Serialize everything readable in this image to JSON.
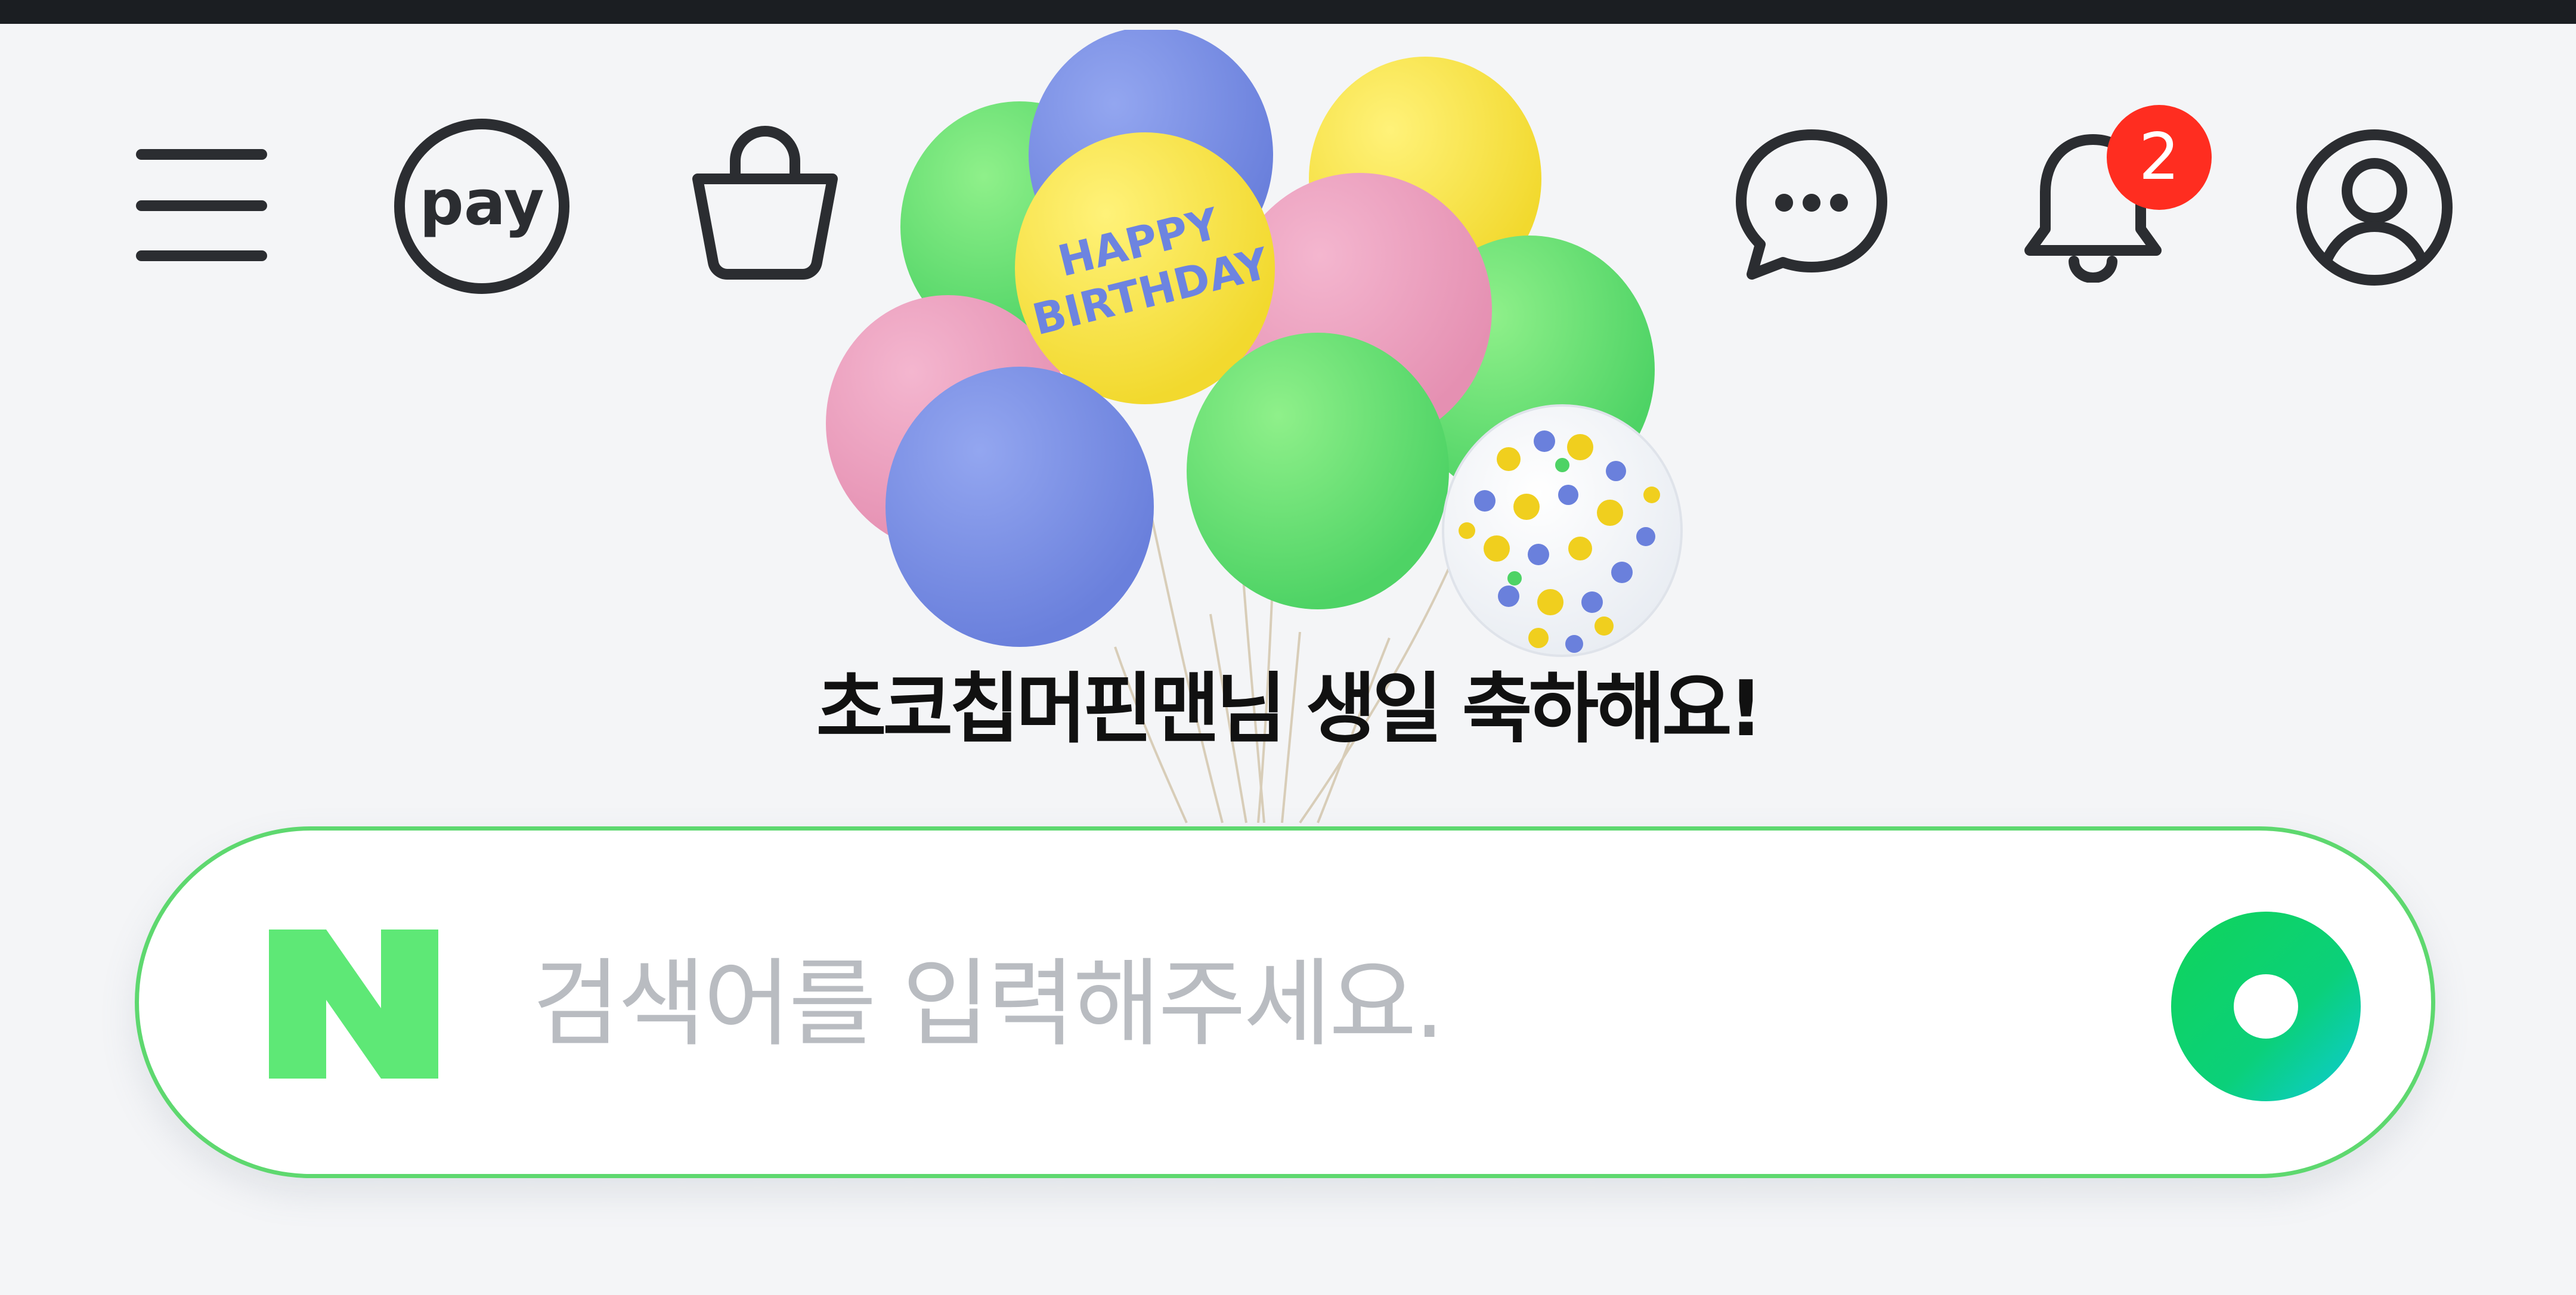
{
  "header": {
    "menu_icon": "hamburger-menu-icon",
    "pay_label": "pay",
    "shopping_icon": "shopping-bag-icon",
    "talk_icon": "chat-bubble-icon",
    "notification_icon": "bell-icon",
    "notification_count": "2",
    "profile_icon": "user-profile-icon"
  },
  "greeting": {
    "text": "초코칩머핀맨님 생일 축하해요!",
    "balloon_text_line1": "HAPPY",
    "balloon_text_line2": "BIRTHDAY"
  },
  "search": {
    "logo_text": "N",
    "placeholder": "검색어를 입력해주세요.",
    "value": ""
  },
  "colors": {
    "brand_green": "#03c75a",
    "search_border": "#5ed86f",
    "badge_red": "#ff2d20",
    "icon_dark": "#2b2d31"
  }
}
